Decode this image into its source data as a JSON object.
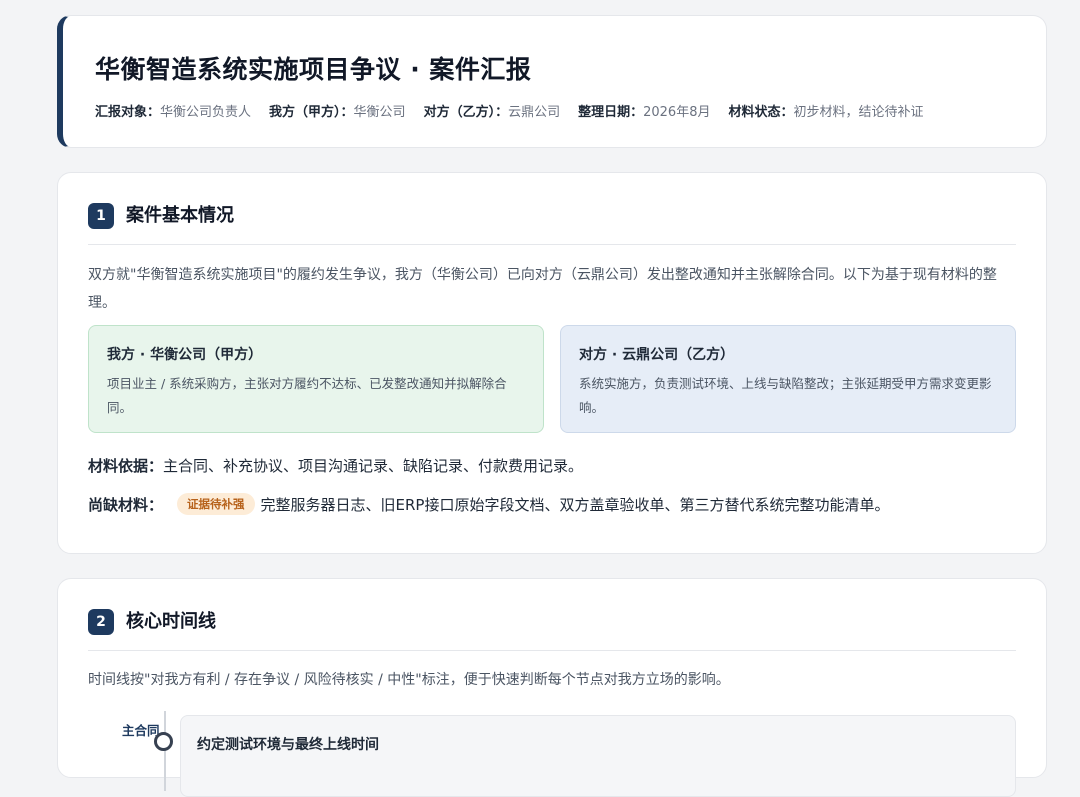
{
  "header": {
    "title": "华衡智造系统实施项目争议 · 案件汇报",
    "meta": [
      {
        "key": "汇报对象：",
        "value": "华衡公司负责人"
      },
      {
        "key": "我方（甲方）：",
        "value": "华衡公司"
      },
      {
        "key": "对方（乙方）：",
        "value": "云鼎公司"
      },
      {
        "key": "整理日期：",
        "value": "2026年8月"
      },
      {
        "key": "材料状态：",
        "value": "初步材料，结论待补证"
      }
    ]
  },
  "section1": {
    "number": "1",
    "title": "案件基本情况",
    "intro": "双方就\"华衡智造系统实施项目\"的履约发生争议，我方（华衡公司）已向对方（云鼎公司）发出整改通知并主张解除合同。以下为基于现有材料的整理。",
    "party_a": {
      "name": "我方 · 华衡公司（甲方）",
      "desc": "项目业主 / 系统采购方，主张对方履约不达标、已发整改通知并拟解除合同。"
    },
    "party_b": {
      "name": "对方 · 云鼎公司（乙方）",
      "desc": "系统实施方，负责测试环境、上线与缺陷整改；主张延期受甲方需求变更影响。"
    },
    "basis_label": "材料依据：",
    "basis_text": "主合同、补充协议、项目沟通记录、缺陷记录、付款费用记录。",
    "missing_label": "尚缺材料：",
    "missing_tag": "证据待补强",
    "missing_text": "完整服务器日志、旧ERP接口原始字段文档、双方盖章验收单、第三方替代系统完整功能清单。"
  },
  "section2": {
    "number": "2",
    "title": "核心时间线",
    "note": "时间线按\"对我方有利 / 存在争议 / 风险待核实 / 中性\"标注，便于快速判断每个节点对我方立场的影响。",
    "timeline": [
      {
        "label": "主合同",
        "title": "约定测试环境与最终上线时间"
      }
    ]
  },
  "colors": {
    "accent": "#1e3a5f",
    "party_a_bg": "#e8f5ec",
    "party_b_bg": "#e6edf7",
    "tag_bg": "#fdecd7",
    "tag_text": "#b7621b"
  }
}
